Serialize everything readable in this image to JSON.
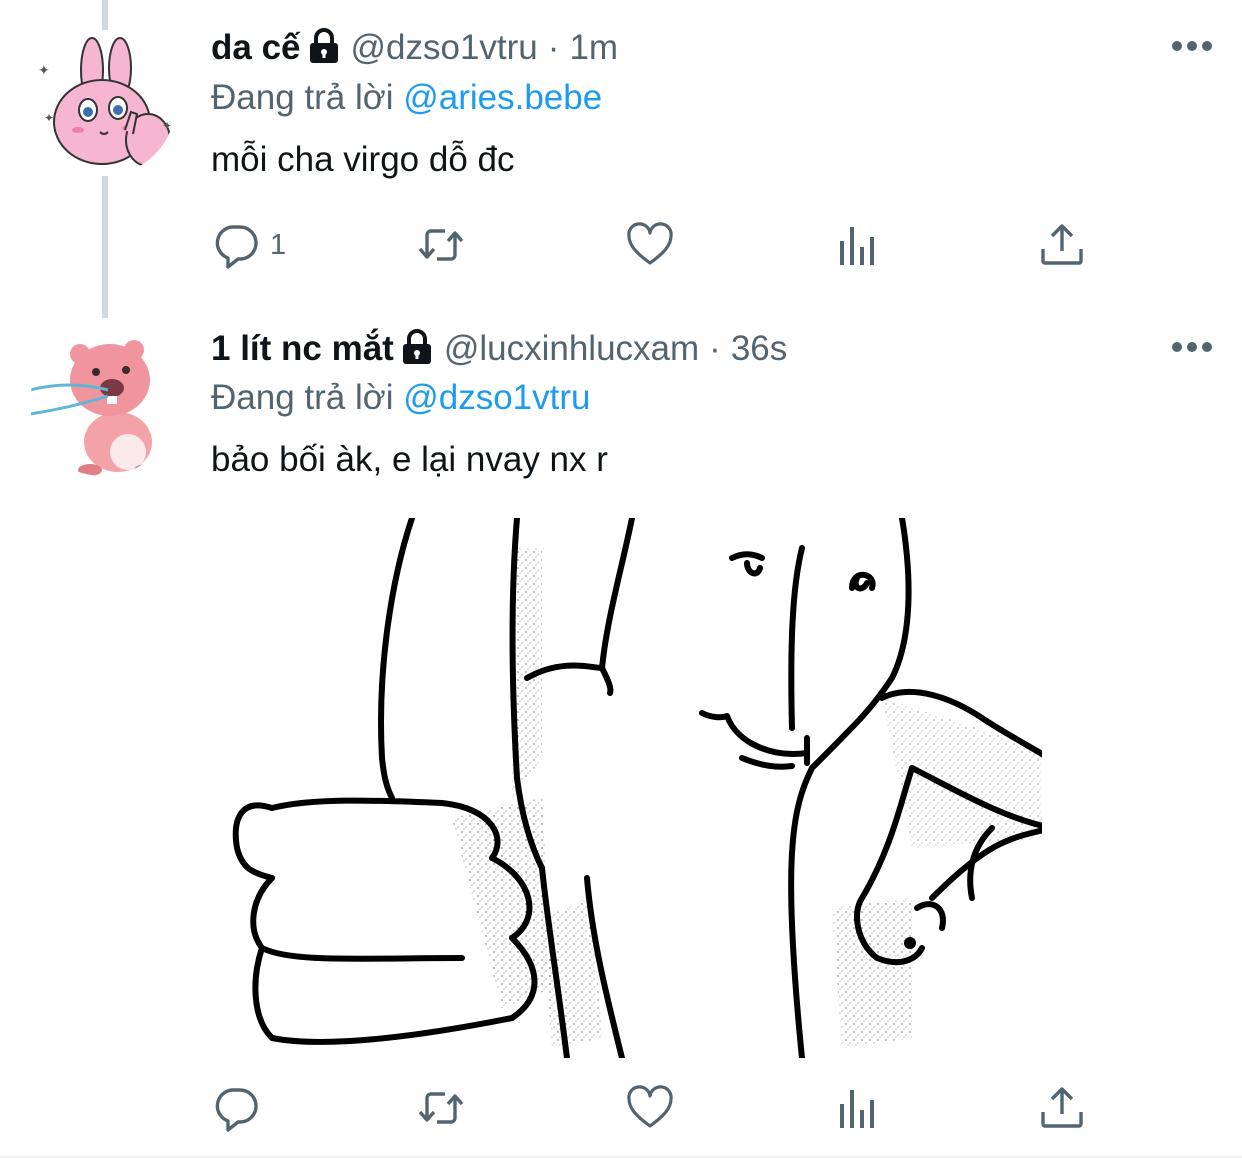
{
  "tweets": [
    {
      "display_name": "da cế",
      "handle": "@dzso1vtru",
      "separator": "·",
      "time": "1m",
      "reply_prefix": "Đang trả lời",
      "reply_to": "@aries.bebe",
      "text": "mỗi cha virgo dỗ đc",
      "reply_count": "1",
      "avatar_icon": "pink-bunny-avatar"
    },
    {
      "display_name": "1 lít nc mắt",
      "handle": "@lucxinhlucxam",
      "separator": "·",
      "time": "36s",
      "reply_prefix": "Đang trả lời",
      "reply_to": "@dzso1vtru",
      "text": "bảo bối àk, e lại nvay nx r",
      "reply_count": "",
      "avatar_icon": "pink-beaver-avatar",
      "media": "hand-drawn-thumbs-up-meme-image"
    }
  ],
  "icons": {
    "lock": "lock-icon",
    "more": "more-dots-icon",
    "reply": "reply-bubble-icon",
    "retweet": "retweet-icon",
    "like": "heart-icon",
    "views": "bar-chart-icon",
    "share": "share-upload-icon"
  },
  "colors": {
    "text": "#0f1419",
    "secondary": "#536471",
    "link": "#1d9bf0",
    "thread_line": "#cfd9de"
  }
}
